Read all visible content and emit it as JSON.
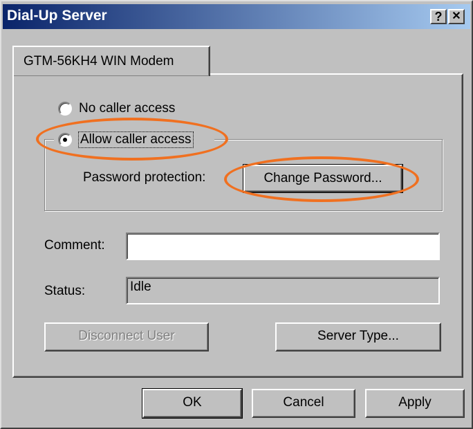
{
  "window": {
    "title": "Dial-Up Server",
    "help_glyph": "?",
    "close_glyph": "✕"
  },
  "tab": {
    "label": "GTM-56KH4 WIN Modem"
  },
  "access": {
    "no_caller_label": "No caller access",
    "allow_caller_label": "Allow caller access",
    "selected": "allow"
  },
  "password": {
    "label": "Password protection:",
    "button": "Change Password..."
  },
  "comment": {
    "label": "Comment:",
    "value": ""
  },
  "status": {
    "label": "Status:",
    "value": "Idle"
  },
  "buttons": {
    "disconnect": "Disconnect User",
    "server_type": "Server Type...",
    "ok": "OK",
    "cancel": "Cancel",
    "apply": "Apply"
  },
  "annotation_color": "#f07020"
}
